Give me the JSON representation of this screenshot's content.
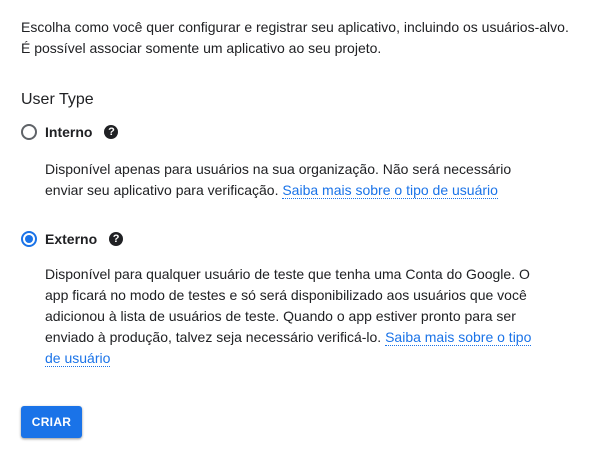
{
  "intro": {
    "text": "Escolha como você quer configurar e registrar seu aplicativo, incluindo os usuários-alvo. É possível associar somente um aplicativo ao seu projeto."
  },
  "user_type": {
    "title": "User Type",
    "options": [
      {
        "label": "Interno",
        "selected": false,
        "help_icon": "help-circle-icon",
        "description": "Disponível apenas para usuários na sua organização. Não será necessário enviar seu aplicativo para verificação. ",
        "link": "Saiba mais sobre o tipo de usuário"
      },
      {
        "label": "Externo",
        "selected": true,
        "help_icon": "help-circle-icon",
        "description": "Disponível para qualquer usuário de teste que tenha uma Conta do Google. O app ficará no modo de testes e só será disponibilizado aos usuários que você adicionou à lista de usuários de teste. Quando o app estiver pronto para ser enviado à produção, talvez seja necessário verificá-lo. ",
        "link": "Saiba mais sobre o tipo de usuário"
      }
    ]
  },
  "actions": {
    "create_label": "CRIAR"
  },
  "colors": {
    "accent": "#1a73e8",
    "text": "#202124",
    "radio_unchecked": "#5f6368"
  }
}
